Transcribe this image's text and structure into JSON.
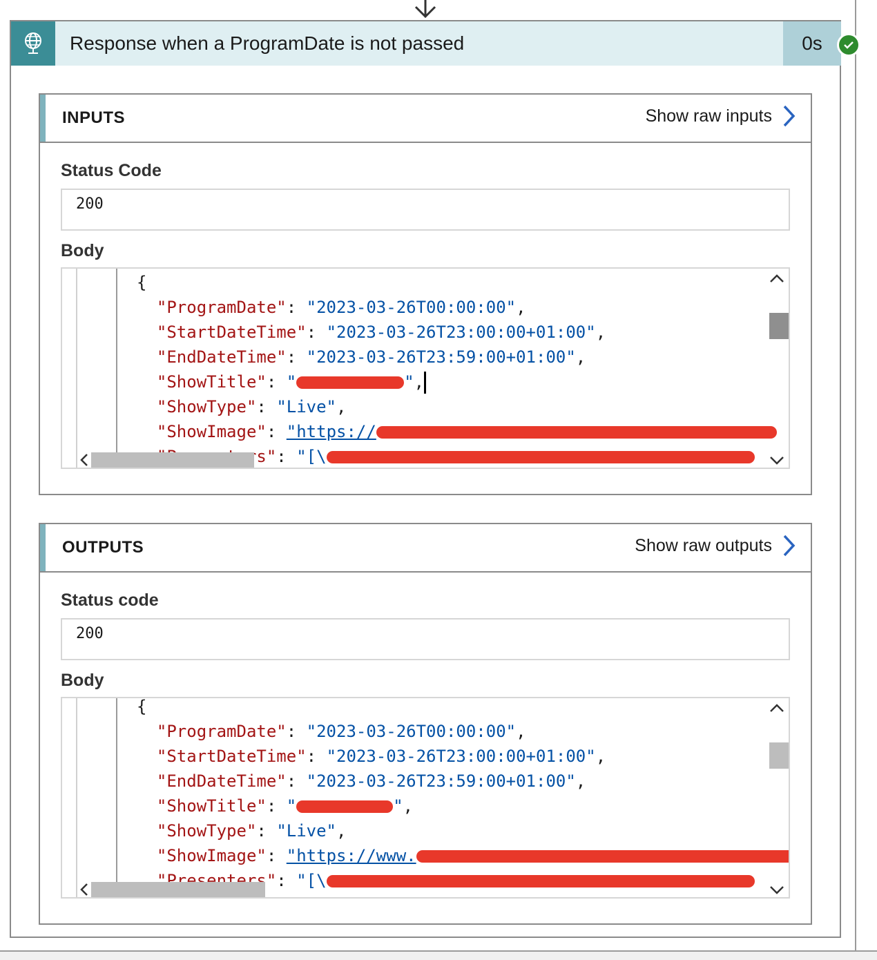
{
  "action": {
    "title": "Response when a ProgramDate is not passed",
    "duration": "0s",
    "icon": "globe-request-icon",
    "status_icon": "check-circle-icon",
    "status_color": "#2e8b2e",
    "header_color": "#dfeff2",
    "icon_bg_color": "#3b8d96"
  },
  "inputs": {
    "title": "INPUTS",
    "raw_link": "Show raw inputs",
    "status_label": "Status Code",
    "status_value": "200",
    "body_label": "Body",
    "body_lines": {
      "open": "{",
      "program_date_key": "\"ProgramDate\"",
      "program_date_value": "\"2023-03-26T00:00:00\"",
      "start_key": "\"StartDateTime\"",
      "start_value": "\"2023-03-26T23:00:00+01:00\"",
      "end_key": "\"EndDateTime\"",
      "end_value": "\"2023-03-26T23:59:00+01:00\"",
      "title_key": "\"ShowTitle\"",
      "type_key": "\"ShowType\"",
      "type_value": "\"Live\"",
      "image_key": "\"ShowImage\"",
      "image_value": "\"https://",
      "presenters_key": "\"Presenters\"",
      "presenters_value": "\"[\\"
    }
  },
  "outputs": {
    "title": "OUTPUTS",
    "raw_link": "Show raw outputs",
    "status_label": "Status code",
    "status_value": "200",
    "body_label": "Body",
    "body_lines": {
      "open": "{",
      "program_date_key": "\"ProgramDate\"",
      "program_date_value": "\"2023-03-26T00:00:00\"",
      "start_key": "\"StartDateTime\"",
      "start_value": "\"2023-03-26T23:00:00+01:00\"",
      "end_key": "\"EndDateTime\"",
      "end_value": "\"2023-03-26T23:59:00+01:00\"",
      "title_key": "\"ShowTitle\"",
      "type_key": "\"ShowType\"",
      "type_value": "\"Live\"",
      "image_key": "\"ShowImage\"",
      "image_value": "\"https://www.",
      "presenters_key": "\"Presenters\"",
      "presenters_value": "\"[\\"
    }
  },
  "colors": {
    "json_key": "#a31515",
    "json_string": "#0451a5",
    "redaction": "#e8382a",
    "link_chevron": "#2a64c0"
  }
}
